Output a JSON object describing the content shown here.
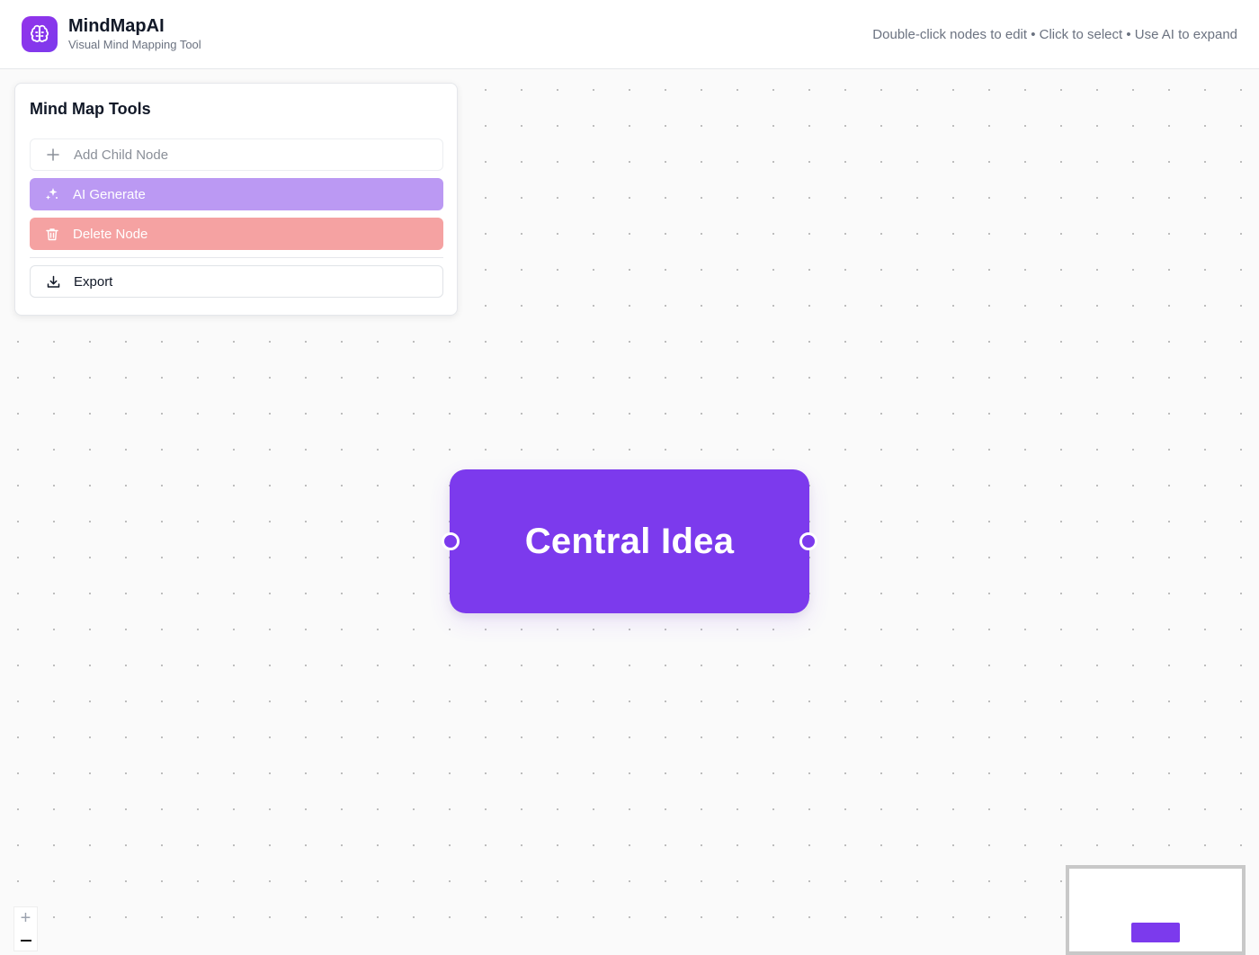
{
  "header": {
    "title": "MindMapAI",
    "subtitle": "Visual Mind Mapping Tool",
    "hint": "Double-click nodes to edit • Click to select • Use AI to expand",
    "logo_icon": "brain-icon"
  },
  "tools": {
    "title": "Mind Map Tools",
    "add_child": {
      "label": "Add Child Node",
      "icon": "plus-icon"
    },
    "ai_generate": {
      "label": "AI Generate",
      "icon": "sparkles-icon"
    },
    "delete_node": {
      "label": "Delete Node",
      "icon": "trash-icon"
    },
    "export": {
      "label": "Export",
      "icon": "download-icon"
    }
  },
  "canvas": {
    "nodes": [
      {
        "label": "Central Idea"
      }
    ],
    "zoom_in_label": "+"
  },
  "colors": {
    "accent": "#7c3aed",
    "ai_button": "#bb99f3",
    "delete_button": "#f5a2a2",
    "background": "#fafafa"
  }
}
